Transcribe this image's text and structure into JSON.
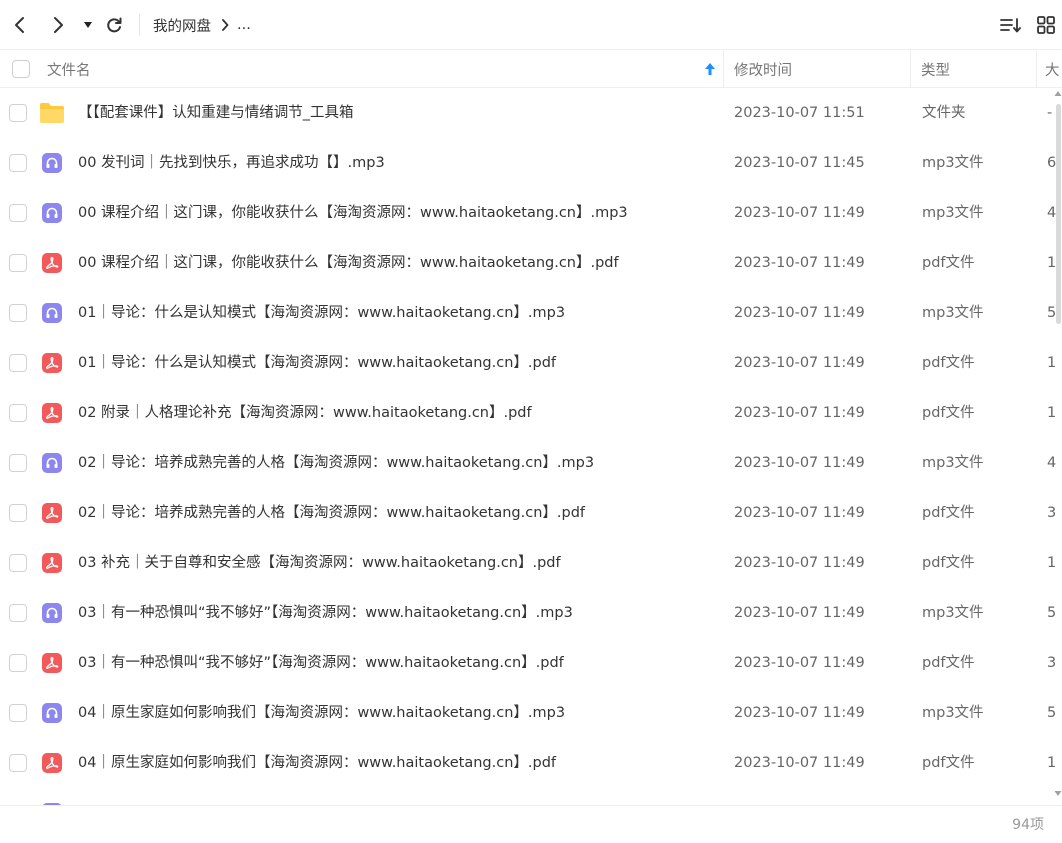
{
  "toolbar": {
    "breadcrumb": [
      {
        "label": "我的网盘"
      },
      {
        "label": "..."
      }
    ]
  },
  "header": {
    "name": "文件名",
    "modified": "修改时间",
    "type": "类型",
    "size": "大"
  },
  "rows": [
    {
      "icon": "folder-icon",
      "name": "【【配套课件】认知重建与情绪调节_工具箱",
      "time": "2023-10-07 11:51",
      "type": "文件夹",
      "size": "-"
    },
    {
      "icon": "audio-file-icon",
      "name": "00 发刊词｜先找到快乐，再追求成功【】.mp3",
      "time": "2023-10-07 11:45",
      "type": "mp3文件",
      "size": "6"
    },
    {
      "icon": "audio-file-icon",
      "name": "00 课程介绍｜这门课，你能收获什么【海淘资源网：www.haitaoketang.cn】.mp3",
      "time": "2023-10-07 11:49",
      "type": "mp3文件",
      "size": "4"
    },
    {
      "icon": "pdf-file-icon",
      "name": "00 课程介绍｜这门课，你能收获什么【海淘资源网：www.haitaoketang.cn】.pdf",
      "time": "2023-10-07 11:49",
      "type": "pdf文件",
      "size": "1"
    },
    {
      "icon": "audio-file-icon",
      "name": "01｜导论：什么是认知模式【海淘资源网：www.haitaoketang.cn】.mp3",
      "time": "2023-10-07 11:49",
      "type": "mp3文件",
      "size": "5"
    },
    {
      "icon": "pdf-file-icon",
      "name": "01｜导论：什么是认知模式【海淘资源网：www.haitaoketang.cn】.pdf",
      "time": "2023-10-07 11:49",
      "type": "pdf文件",
      "size": "1"
    },
    {
      "icon": "pdf-file-icon",
      "name": "02 附录｜人格理论补充【海淘资源网：www.haitaoketang.cn】.pdf",
      "time": "2023-10-07 11:49",
      "type": "pdf文件",
      "size": "1"
    },
    {
      "icon": "audio-file-icon",
      "name": "02｜导论：培养成熟完善的人格【海淘资源网：www.haitaoketang.cn】.mp3",
      "time": "2023-10-07 11:49",
      "type": "mp3文件",
      "size": "4"
    },
    {
      "icon": "pdf-file-icon",
      "name": "02｜导论：培养成熟完善的人格【海淘资源网：www.haitaoketang.cn】.pdf",
      "time": "2023-10-07 11:49",
      "type": "pdf文件",
      "size": "3"
    },
    {
      "icon": "pdf-file-icon",
      "name": "03 补充｜关于自尊和安全感【海淘资源网：www.haitaoketang.cn】.pdf",
      "time": "2023-10-07 11:49",
      "type": "pdf文件",
      "size": "1"
    },
    {
      "icon": "audio-file-icon",
      "name": "03｜有一种恐惧叫“我不够好”【海淘资源网：www.haitaoketang.cn】.mp3",
      "time": "2023-10-07 11:49",
      "type": "mp3文件",
      "size": "5"
    },
    {
      "icon": "pdf-file-icon",
      "name": "03｜有一种恐惧叫“我不够好”【海淘资源网：www.haitaoketang.cn】.pdf",
      "time": "2023-10-07 11:49",
      "type": "pdf文件",
      "size": "3"
    },
    {
      "icon": "audio-file-icon",
      "name": "04｜原生家庭如何影响我们【海淘资源网：www.haitaoketang.cn】.mp3",
      "time": "2023-10-07 11:49",
      "type": "mp3文件",
      "size": "5"
    },
    {
      "icon": "pdf-file-icon",
      "name": "04｜原生家庭如何影响我们【海淘资源网：www.haitaoketang.cn】.pdf",
      "time": "2023-10-07 11:49",
      "type": "pdf文件",
      "size": "1"
    }
  ],
  "footer": {
    "count": "94项"
  },
  "colors": {
    "audio_icon": "#8d86f0",
    "pdf_icon": "#f2595b",
    "folder_icon": "#ffc83d",
    "sort_arrow": "#1f8fff"
  }
}
